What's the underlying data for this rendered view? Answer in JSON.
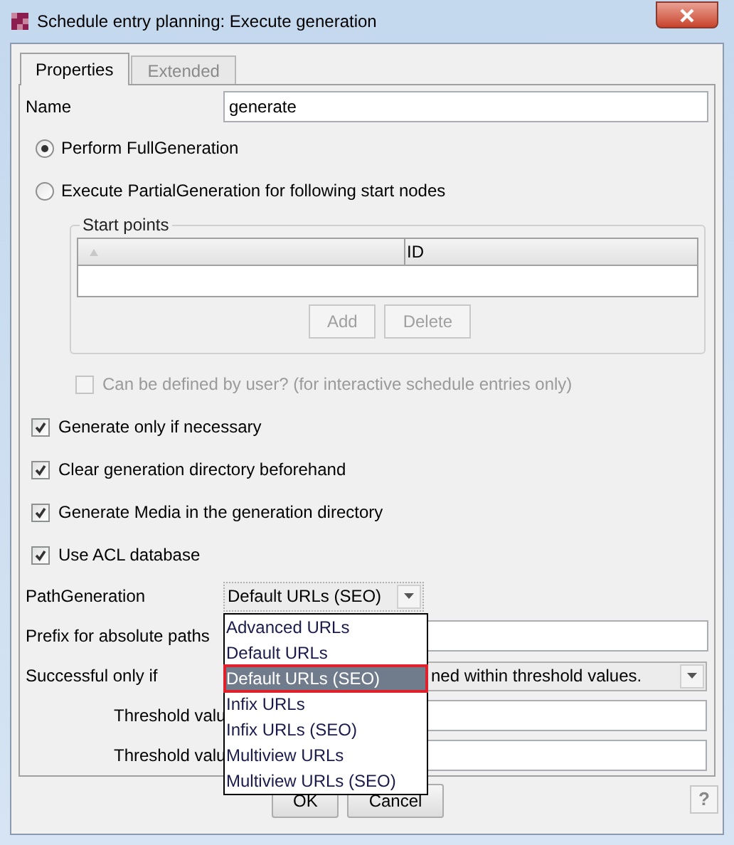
{
  "window": {
    "title": "Schedule entry planning: Execute generation"
  },
  "tabs": [
    {
      "label": "Properties",
      "selected": true
    },
    {
      "label": "Extended",
      "selected": false
    }
  ],
  "name_field": {
    "label": "Name",
    "value": "generate"
  },
  "generation_mode": [
    {
      "label": "Perform FullGeneration",
      "selected": true
    },
    {
      "label": "Execute PartialGeneration for following start nodes",
      "selected": false
    }
  ],
  "start_points": {
    "title": "Start points",
    "columns": [
      {
        "kind": "sort"
      },
      {
        "kind": "text",
        "label": "ID"
      }
    ],
    "buttons": [
      {
        "label": "Add",
        "disabled": true
      },
      {
        "label": "Delete",
        "disabled": true
      }
    ]
  },
  "user_definable": {
    "label": "Can be defined by user? (for interactive schedule entries only)",
    "checked": false,
    "disabled": true
  },
  "options": [
    {
      "label": "Generate only if necessary",
      "checked": true
    },
    {
      "label": "Clear generation directory beforehand",
      "checked": true
    },
    {
      "label": "Generate Media in the generation directory",
      "checked": true
    },
    {
      "label": "Use ACL database",
      "checked": true
    }
  ],
  "path_generation": {
    "label": "PathGeneration",
    "value": "Default URLs (SEO)",
    "expanded": true,
    "options": [
      {
        "label": "Advanced URLs",
        "selected": false
      },
      {
        "label": "Default URLs",
        "selected": false
      },
      {
        "label": "Default URLs (SEO)",
        "selected": true
      },
      {
        "label": "Infix URLs",
        "selected": false
      },
      {
        "label": "Infix URLs (SEO)",
        "selected": false
      },
      {
        "label": "Multiview URLs",
        "selected": false
      },
      {
        "label": "Multiview URLs (SEO)",
        "selected": false
      }
    ]
  },
  "prefix": {
    "label": "Prefix for absolute paths"
  },
  "success": {
    "label": "Successful only if",
    "value": "ned within threshold values."
  },
  "thresholds": [
    {
      "label": "Threshold valu"
    },
    {
      "label": "Threshold valu"
    }
  ],
  "footer_buttons": [
    {
      "label": "OK"
    },
    {
      "label": "Cancel"
    }
  ],
  "help": "?"
}
